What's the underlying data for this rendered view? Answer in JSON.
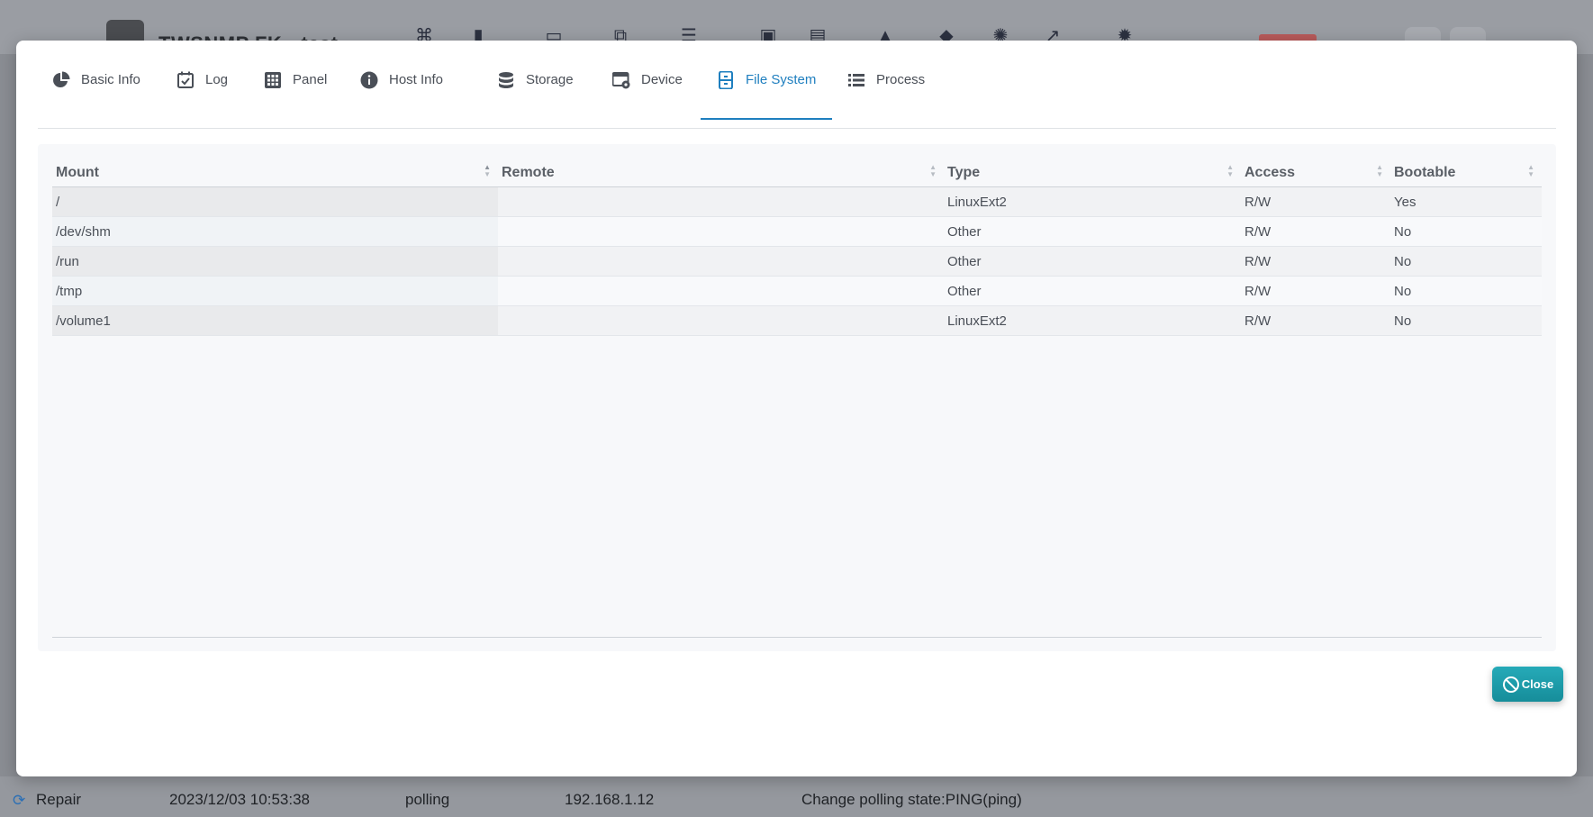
{
  "background": {
    "app_title": "TWSNMP FK - test",
    "event_row": {
      "level": "Repair",
      "time": "2023/12/03 10:53:38",
      "type": "polling",
      "node": "192.168.1.12",
      "event": "Change polling state:PING(ping)"
    }
  },
  "tabs": [
    {
      "label": "Basic Info",
      "icon": "pie-chart-icon"
    },
    {
      "label": "Log",
      "icon": "calendar-check-icon"
    },
    {
      "label": "Panel",
      "icon": "grid-icon"
    },
    {
      "label": "Host Info",
      "icon": "info-icon"
    },
    {
      "label": "Storage",
      "icon": "database-icon"
    },
    {
      "label": "Device",
      "icon": "device-settings-icon"
    },
    {
      "label": "File System",
      "icon": "file-cabinet-icon",
      "active": true
    },
    {
      "label": "Process",
      "icon": "list-icon"
    }
  ],
  "table": {
    "columns": [
      "Mount",
      "Remote",
      "Type",
      "Access",
      "Bootable"
    ],
    "rows": [
      {
        "mount": "/",
        "remote": "",
        "type": "LinuxExt2",
        "access": "R/W",
        "bootable": "Yes"
      },
      {
        "mount": "/dev/shm",
        "remote": "",
        "type": "Other",
        "access": "R/W",
        "bootable": "No"
      },
      {
        "mount": "/run",
        "remote": "",
        "type": "Other",
        "access": "R/W",
        "bootable": "No"
      },
      {
        "mount": "/tmp",
        "remote": "",
        "type": "Other",
        "access": "R/W",
        "bootable": "No"
      },
      {
        "mount": "/volume1",
        "remote": "",
        "type": "LinuxExt2",
        "access": "R/W",
        "bootable": "No"
      }
    ]
  },
  "close_button": {
    "label": "Close",
    "icon": "ban-icon"
  },
  "colors": {
    "accent": "#1f7fbf",
    "close_button": "#1f9aa8"
  }
}
